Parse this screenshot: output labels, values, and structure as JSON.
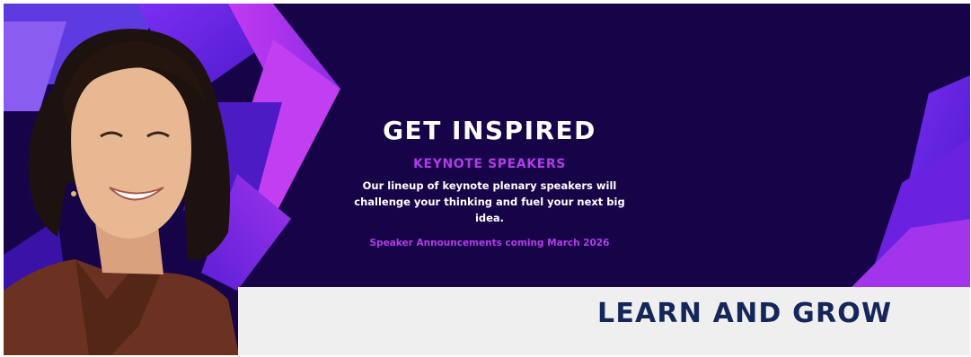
{
  "hero": {
    "title": "GET INSPIRED",
    "subtitle": "KEYNOTE SPEAKERS",
    "description": "Our lineup of keynote plenary speakers will challenge your thinking and fuel your next big idea.",
    "announcement": "Speaker Announcements coming March 2026"
  },
  "section": {
    "heading": "LEARN AND GROW"
  },
  "colors": {
    "background": "#170448",
    "accent_purple": "#b23be8",
    "heading_navy": "#15265a",
    "panel_gray": "#efefef"
  },
  "images": {
    "speaker_photo": "smiling woman with dark bob haircut in brown collared shirt"
  }
}
